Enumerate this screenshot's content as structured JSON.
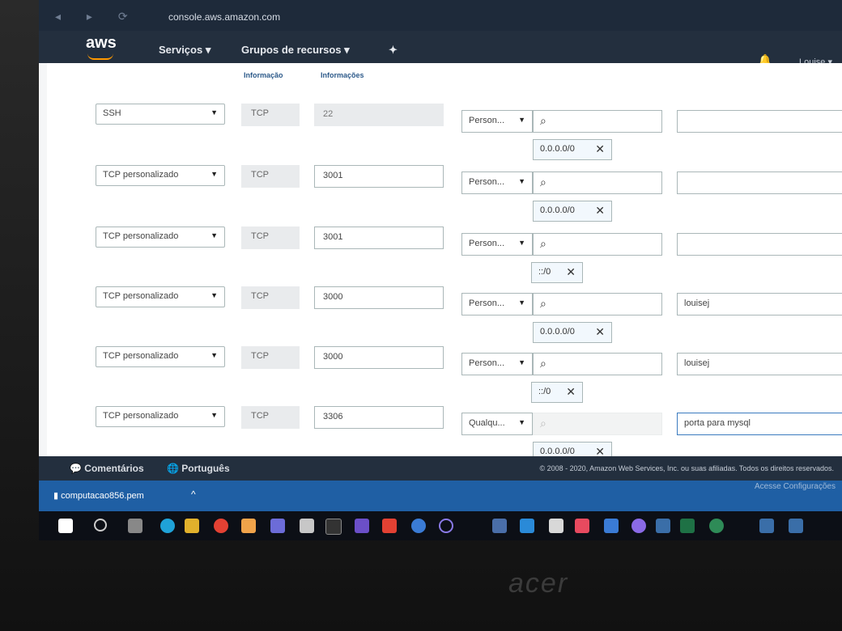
{
  "browser": {
    "url": "console.aws.amazon.com"
  },
  "aws": {
    "logo": "aws",
    "nav_services": "Serviços",
    "nav_resource_groups": "Grupos de recursos",
    "user": "Louise"
  },
  "table": {
    "col_protocol": "Informação",
    "col_port": "Informações"
  },
  "rules": [
    {
      "type": "SSH",
      "protocol": "TCP",
      "port": "22",
      "port_disabled": true,
      "source_type": "Person...",
      "description": "",
      "token": "0.0.0.0/0"
    },
    {
      "type": "TCP personalizado",
      "protocol": "TCP",
      "port": "3001",
      "port_disabled": false,
      "source_type": "Person...",
      "description": "",
      "token": "0.0.0.0/0"
    },
    {
      "type": "TCP personalizado",
      "protocol": "TCP",
      "port": "3001",
      "port_disabled": false,
      "source_type": "Person...",
      "description": "",
      "token": "::/0"
    },
    {
      "type": "TCP personalizado",
      "protocol": "TCP",
      "port": "3000",
      "port_disabled": false,
      "source_type": "Person...",
      "description": "louisej",
      "token": "0.0.0.0/0"
    },
    {
      "type": "TCP personalizado",
      "protocol": "TCP",
      "port": "3000",
      "port_disabled": false,
      "source_type": "Person...",
      "description": "louisej",
      "token": "::/0"
    },
    {
      "type": "TCP personalizado",
      "protocol": "TCP",
      "port": "3306",
      "port_disabled": false,
      "source_type": "Qualqu...",
      "description": "porta para mysql",
      "token": "0.0.0.0/0"
    }
  ],
  "footer": {
    "feedback": "Comentários",
    "language": "Português",
    "copyright": "© 2008 - 2020, Amazon Web Services, Inc. ou suas afiliadas. Todos os direitos reservados."
  },
  "download": {
    "filename": "computacao856.pem",
    "right_text": "Acesse Configurações"
  },
  "device": {
    "brand": "acer"
  },
  "colors": {
    "aws_dark": "#232f3e",
    "aws_orange": "#ff9900",
    "download_bar": "#1f5fa4"
  }
}
